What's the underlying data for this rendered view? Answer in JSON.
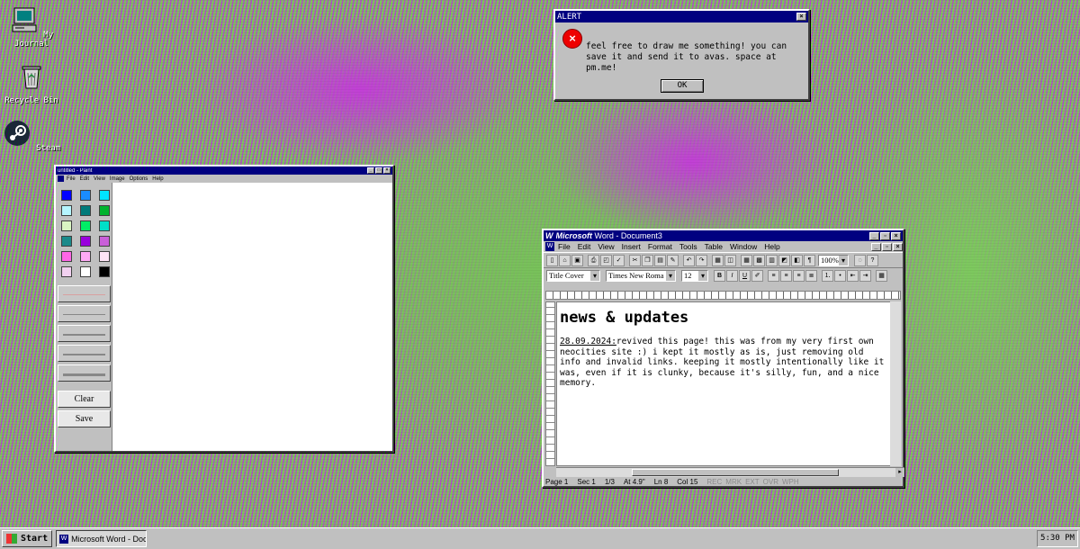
{
  "desktop": {
    "icons": [
      {
        "label": "My Journal",
        "icon": "computer-icon"
      },
      {
        "label": "Recycle Bin",
        "icon": "recycle-bin-icon"
      },
      {
        "label": "Steam",
        "icon": "steam-icon"
      }
    ]
  },
  "alert": {
    "title": "ALERT",
    "message": "feel free to draw me something! you can save it and send it to avas. space at pm.me!",
    "ok_label": "OK"
  },
  "paint": {
    "title": "untitled - Paint",
    "menu": [
      "File",
      "Edit",
      "View",
      "Image",
      "Options",
      "Help"
    ],
    "palette": [
      "#0000ff",
      "#1a8cff",
      "#00e5ff",
      "#b5f5ff",
      "#007a7a",
      "#00b32d",
      "#d9f5c2",
      "#00ee66",
      "#00e0c8",
      "#1a8a8a",
      "#9900dd",
      "#c95fd9",
      "#ff66e6",
      "#ffaaf5",
      "#ffe5f7",
      "#f2d1f0",
      "#ffffff",
      "#000000"
    ],
    "clear_label": "Clear",
    "save_label": "Save"
  },
  "word": {
    "title_bold": "Microsoft",
    "title_rest": " Word - Document3",
    "menu": [
      "File",
      "Edit",
      "View",
      "Insert",
      "Format",
      "Tools",
      "Table",
      "Window",
      "Help"
    ],
    "zoom": "100%",
    "style": "Title Cover",
    "font": "Times New Roma",
    "size": "12",
    "doc_heading": "news & updates",
    "doc_date": "28.09.2024:",
    "doc_body": "revived this page! this was from my very first own neocities site :) i kept it mostly as is, just removing old info and invalid links. keeping it mostly intentionally like it was, even if it is clunky, because it's silly, fun, and a nice memory.",
    "status": {
      "page": "Page 1",
      "sec": "Sec 1",
      "pages": "1/3",
      "at": "At 4.9\"",
      "ln": "Ln 8",
      "col": "Col 15",
      "flags": [
        "REC",
        "MRK",
        "EXT",
        "OVR",
        "WPH"
      ]
    }
  },
  "taskbar": {
    "start_label": "Start",
    "task_label": "Microsoft Word - Doc...",
    "clock": "5:30 PM"
  }
}
